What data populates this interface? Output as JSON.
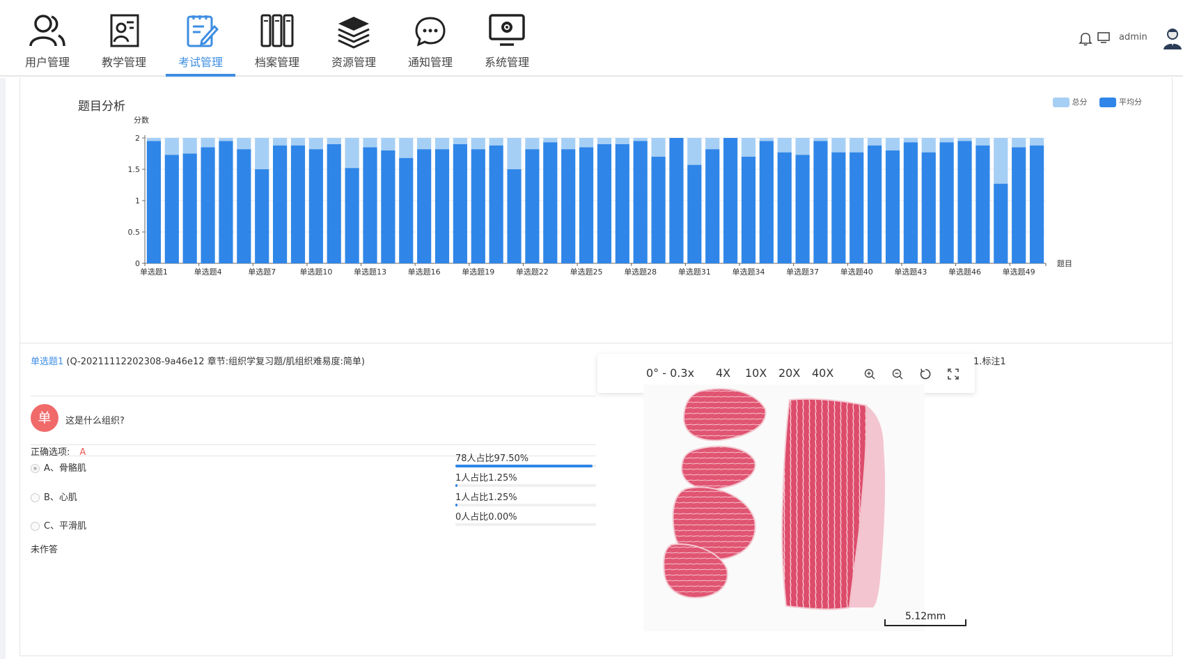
{
  "nav": {
    "items": [
      {
        "label": "用户管理",
        "icon": "users-icon"
      },
      {
        "label": "教学管理",
        "icon": "teaching-board-icon"
      },
      {
        "label": "考试管理",
        "icon": "exam-edit-icon",
        "active": true
      },
      {
        "label": "档案管理",
        "icon": "archive-binders-icon"
      },
      {
        "label": "资源管理",
        "icon": "layers-icon"
      },
      {
        "label": "通知管理",
        "icon": "chat-bubble-icon"
      },
      {
        "label": "系统管理",
        "icon": "monitor-gear-icon"
      }
    ],
    "username": "admin"
  },
  "colors": {
    "accent": "#3d8de2",
    "bar_avg": "#2f86e8",
    "bar_total": "#a6cff5",
    "badge": "#f06a6a",
    "answer": "#f05a5a"
  },
  "chart_data": {
    "type": "bar",
    "title": "题目分析",
    "ylabel": "分数",
    "xlabel": "题目",
    "ylim": [
      0,
      2
    ],
    "yticks": [
      "0",
      "0.5",
      "1",
      "1.5",
      "2"
    ],
    "grid": true,
    "legend_position": "top-right",
    "categories": [
      "单选题1",
      "单选题2",
      "单选题3",
      "单选题4",
      "单选题5",
      "单选题6",
      "单选题7",
      "单选题8",
      "单选题9",
      "单选题10",
      "单选题11",
      "单选题12",
      "单选题13",
      "单选题14",
      "单选题15",
      "单选题16",
      "单选题17",
      "单选题18",
      "单选题19",
      "单选题20",
      "单选题21",
      "单选题22",
      "单选题23",
      "单选题24",
      "单选题25",
      "单选题26",
      "单选题27",
      "单选题28",
      "单选题29",
      "单选题30",
      "单选题31",
      "单选题32",
      "单选题33",
      "单选题34",
      "单选题35",
      "单选题36",
      "单选题37",
      "单选题38",
      "单选题39",
      "单选题40",
      "单选题41",
      "单选题42",
      "单选题43",
      "单选题44",
      "单选题45",
      "单选题46",
      "单选题47",
      "单选题48",
      "单选题49",
      "单选题50"
    ],
    "x_tick_labels": [
      "单选题1",
      "单选题4",
      "单选题7",
      "单选题10",
      "单选题13",
      "单选题16",
      "单选题19",
      "单选题22",
      "单选题25",
      "单选题28",
      "单选题31",
      "单选题34",
      "单选题37",
      "单选题40",
      "单选题43",
      "单选题46",
      "单选题49"
    ],
    "series": [
      {
        "name": "总分",
        "values": [
          2,
          2,
          2,
          2,
          2,
          2,
          2,
          2,
          2,
          2,
          2,
          2,
          2,
          2,
          2,
          2,
          2,
          2,
          2,
          2,
          2,
          2,
          2,
          2,
          2,
          2,
          2,
          2,
          2,
          2,
          2,
          2,
          2,
          2,
          2,
          2,
          2,
          2,
          2,
          2,
          2,
          2,
          2,
          2,
          2,
          2,
          2,
          2,
          2,
          2
        ]
      },
      {
        "name": "平均分",
        "values": [
          1.95,
          1.73,
          1.75,
          1.85,
          1.95,
          1.82,
          1.5,
          1.88,
          1.88,
          1.82,
          1.9,
          1.52,
          1.85,
          1.8,
          1.68,
          1.82,
          1.82,
          1.9,
          1.82,
          1.88,
          1.5,
          1.82,
          1.93,
          1.82,
          1.85,
          1.9,
          1.9,
          1.95,
          1.7,
          2.0,
          1.57,
          1.82,
          2.0,
          1.7,
          1.95,
          1.77,
          1.73,
          1.95,
          1.77,
          1.77,
          1.88,
          1.8,
          1.93,
          1.77,
          1.93,
          1.95,
          1.88,
          1.27,
          1.85,
          1.88
        ]
      }
    ]
  },
  "question": {
    "type_link": "单选题1",
    "meta": " (Q-20211112202308-9a46e12 章节:组织学复习题/肌组织难易度:简单)",
    "badge": "单",
    "text": "这是什么组织?",
    "correct_label": "正确选项:",
    "correct_answer": "A",
    "options": [
      {
        "label": "A、骨骼肌",
        "stat": "78人占比97.50%",
        "ratio": 0.975
      },
      {
        "label": "B、心肌",
        "stat": "1人占比1.25%",
        "ratio": 0.0125
      },
      {
        "label": "C、平滑肌",
        "stat": "1人占比1.25%",
        "ratio": 0.0125
      }
    ],
    "extra_stat": {
      "stat": "0人占比0.00%",
      "ratio": 0
    },
    "status": "未作答"
  },
  "viewer": {
    "angle_zoom": "0° - 0.3x",
    "magnifications": [
      "4X",
      "10X",
      "20X",
      "40X"
    ],
    "annotation": "1.标注1",
    "scale": "5.12mm"
  }
}
